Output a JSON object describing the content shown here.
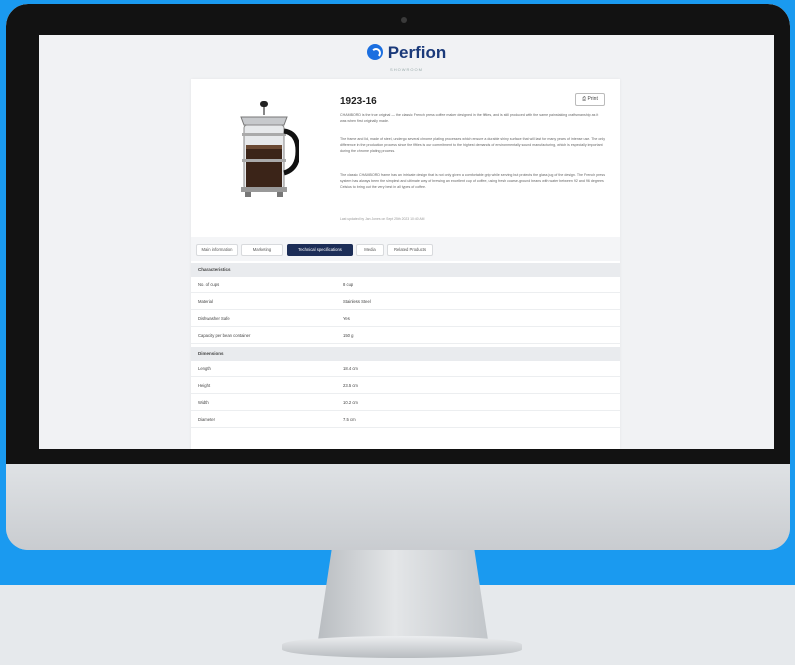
{
  "site": {
    "logo_text": "Perfion",
    "subtitle": "SHOWROOM"
  },
  "product": {
    "id": "1923-16",
    "print_label": "Print",
    "description": [
      "CHAMBORD is the true original — the classic French press coffee maker designed in the fifties, and is still produced with the same painstaking craftsmanship as it was when first originally made.",
      "The frame and lid, made of steel, undergo several chrome plating processes which ensure a durable shiny surface that will last for many years of intense use. The only difference in the production process since the fifties is our commitment to the highest demands of environmentally sound manufacturing, which is especially important during the chrome plating process.",
      "The classic CHAMBORD frame has an intricate design that is not only given a comfortable grip while serving but protects the glass jug of the design. The French press system has always been the simplest and ultimate way of brewing an excellent cup of coffee, using fresh coarse-ground beans with water between 92 and 96 degrees Celsius to bring out the very best in all types of coffee."
    ],
    "note": "Last updated by Jan Jones on Sept 25th 2023 10:40 AM"
  },
  "tabs": [
    "Main information",
    "Marketing",
    "Technical specifications",
    "Media",
    "Related Products"
  ],
  "active_tab": 2,
  "sections": [
    {
      "title": "Characteristics",
      "rows": [
        [
          "No. of cups",
          "8 cup"
        ],
        [
          "Material",
          "Stainless Steel"
        ],
        [
          "Dishwasher Safe",
          "Yes"
        ],
        [
          "Capacity per bean container",
          "150 g"
        ]
      ]
    },
    {
      "title": "Dimensions",
      "rows": [
        [
          "Length",
          "18.4 cm"
        ],
        [
          "Height",
          "23.5 cm"
        ],
        [
          "Width",
          "10.2 cm"
        ],
        [
          "Diameter",
          "7.5 cm"
        ]
      ]
    }
  ],
  "colors": {
    "background": "#1a9af0",
    "accent": "#1c2d57",
    "logo": "#1b3a7a"
  }
}
